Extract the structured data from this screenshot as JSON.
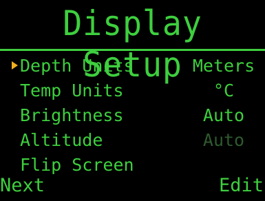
{
  "title": "Display Setup",
  "menu": {
    "items": [
      {
        "label": "Depth Units",
        "value": "Meters",
        "selected": true
      },
      {
        "label": "Temp Units",
        "value": "°C"
      },
      {
        "label": "Brightness",
        "value": "Auto"
      },
      {
        "label": "Altitude",
        "value": "Auto",
        "disabled": true
      },
      {
        "label": "Flip Screen",
        "value": ""
      }
    ]
  },
  "softkeys": {
    "left": "Next",
    "right": "Edit"
  },
  "colors": {
    "background": "#000000",
    "text": "#3ecf3e",
    "disabled_text": "#2e5a2e",
    "cursor": "#f0b020"
  }
}
